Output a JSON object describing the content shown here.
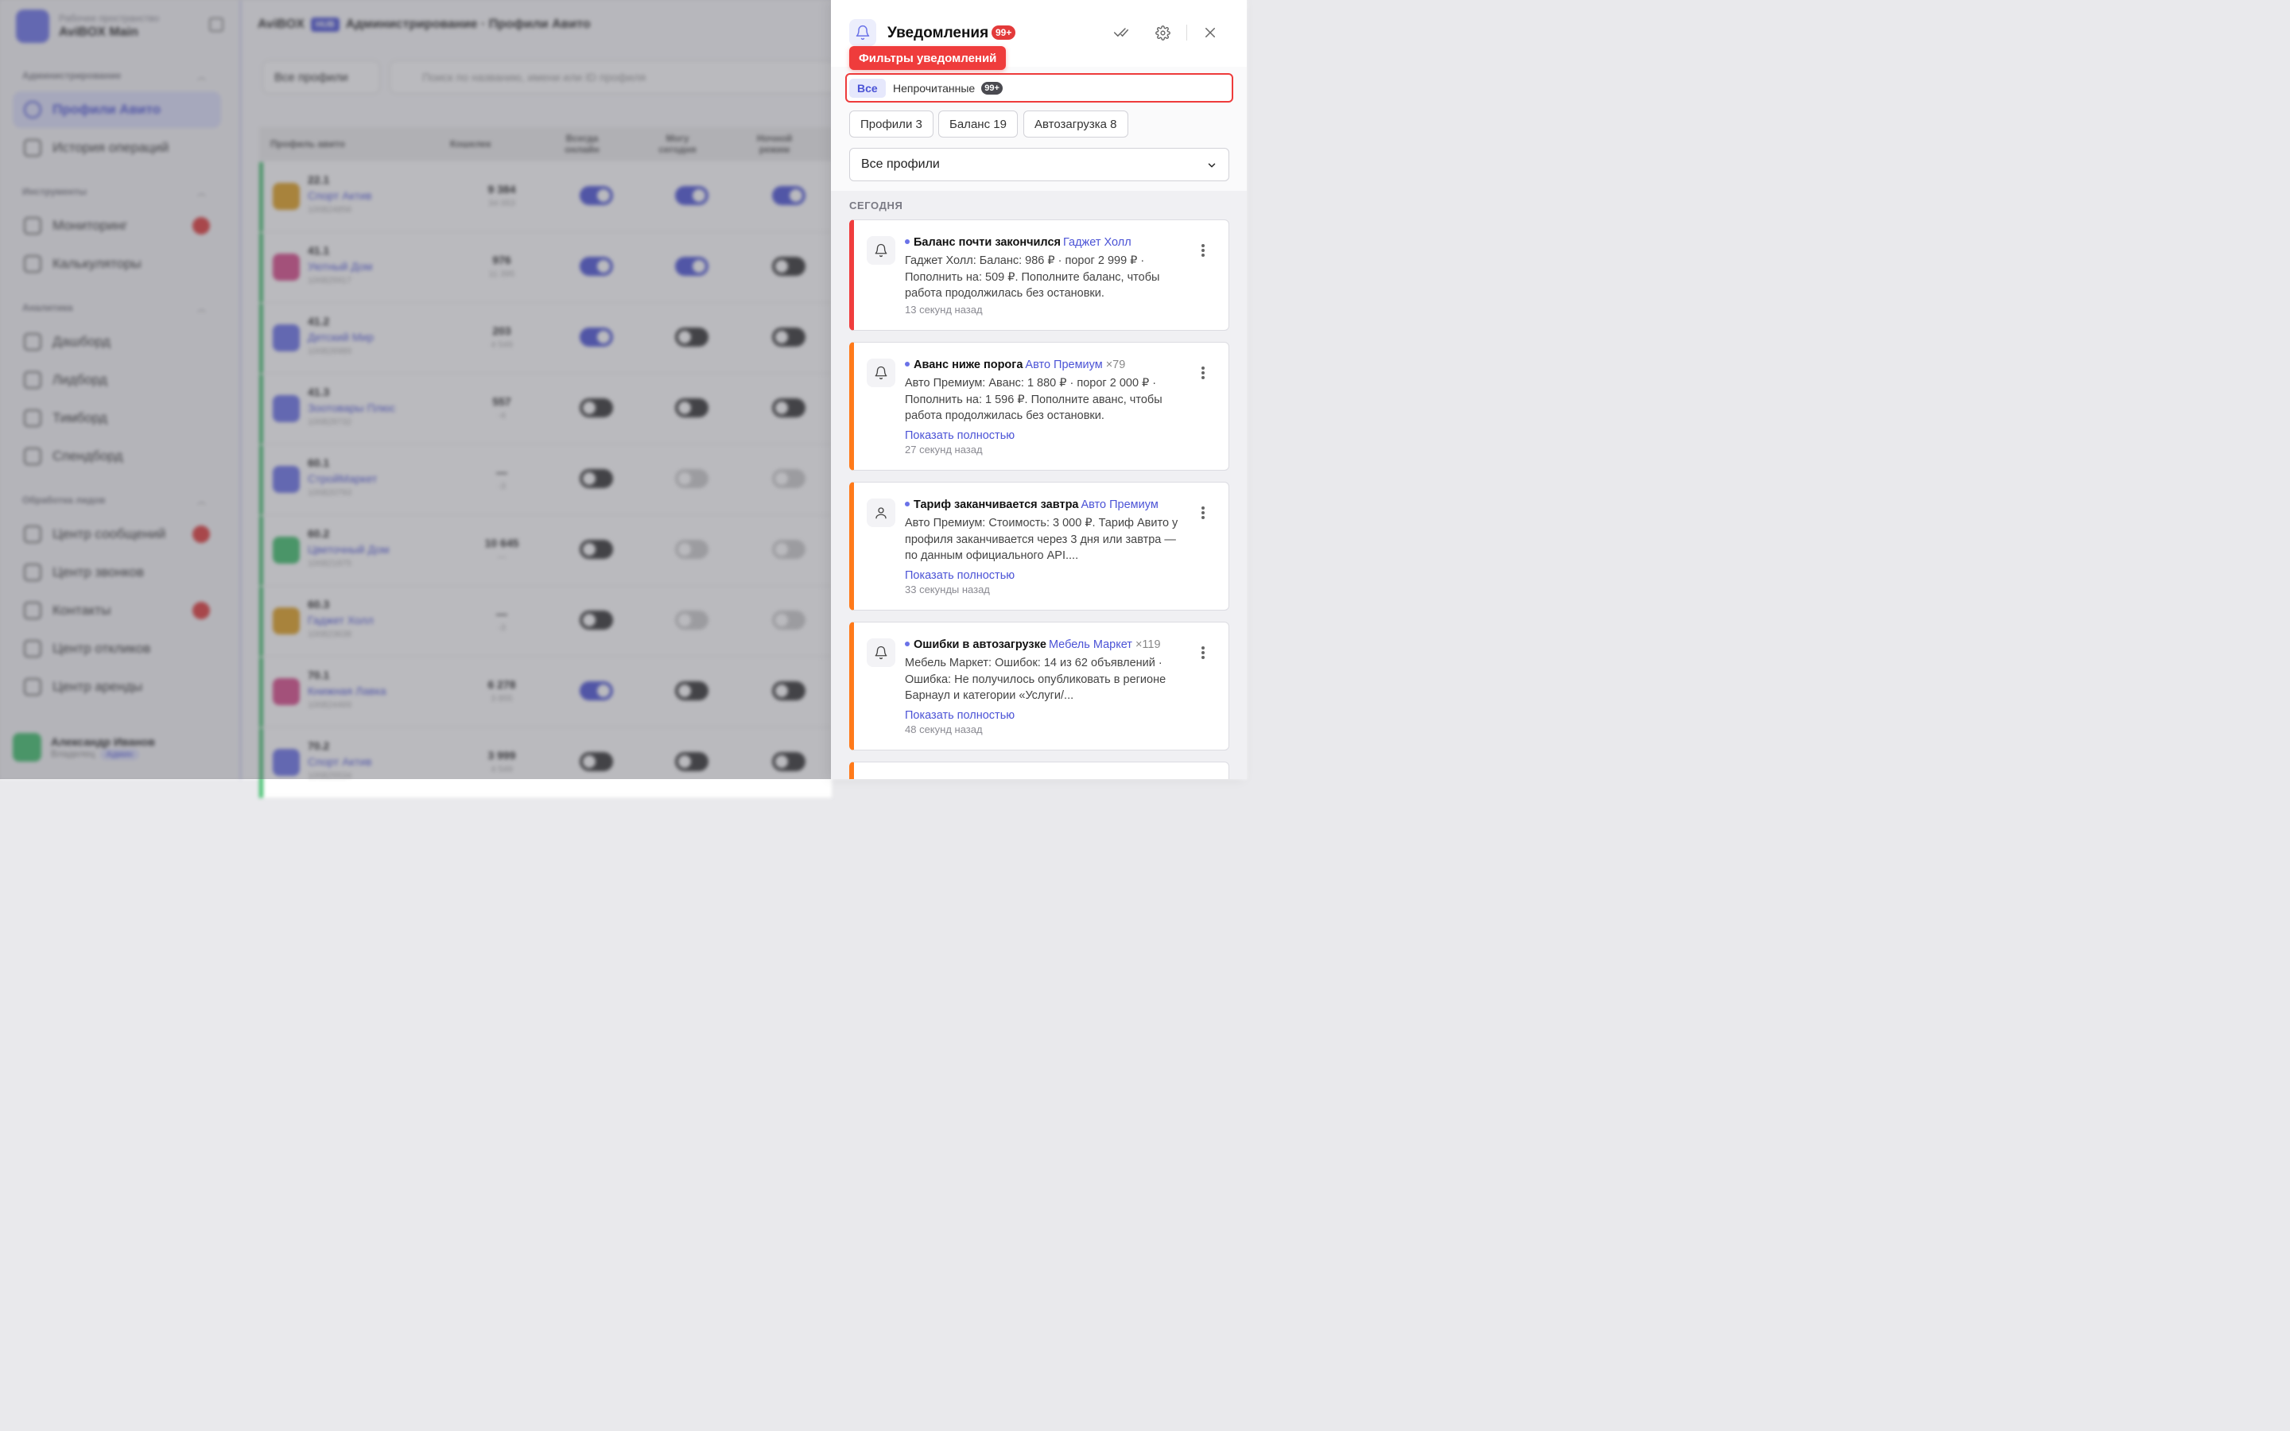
{
  "background": {
    "workspace": {
      "label": "Рабочее пространство",
      "name": "AviBOX Main"
    },
    "sections": [
      "Администрирование",
      "Инструменты",
      "Аналитика",
      "Обработка лидов"
    ],
    "nav": [
      "Профили Авито",
      "История операций",
      "Мониторинг",
      "Калькуляторы",
      "Дашборд",
      "Лидборд",
      "Тимборд",
      "Спендборд",
      "Центр сообщений",
      "Центр звонков",
      "Контакты",
      "Центр откликов",
      "Центр аренды"
    ],
    "user": {
      "name": "Александр Иванов",
      "role": "Владелец",
      "badge": "Админ"
    },
    "page": {
      "brand": "AviBOX",
      "hub": "HUB",
      "title": "Администрирование · Профили Авито"
    },
    "filter": "Все профили",
    "search_placeholder": "Поиск по названию, имени или ID профиля",
    "columns": [
      "Профиль авито",
      "Кошелек",
      "Всегда онлайн",
      "Могу сегодня",
      "Ночной режим"
    ],
    "rows": [
      {
        "id": "22.1",
        "name": "Спорт Актив",
        "num": "100824856",
        "wallet": "9 384",
        "sub": "34 053",
        "color": "#e0a020",
        "t": [
          "on",
          "on",
          "on"
        ]
      },
      {
        "id": "41.1",
        "name": "Уютный Дом",
        "num": "100825917",
        "wallet": "976",
        "sub": "11 395",
        "color": "#d84a8a",
        "t": [
          "on",
          "on",
          "off"
        ]
      },
      {
        "id": "41.2",
        "name": "Детский Мир",
        "num": "100826989",
        "wallet": "203",
        "sub": "4 549",
        "color": "#6a72e8",
        "t": [
          "on",
          "off",
          "off"
        ]
      },
      {
        "id": "41.3",
        "name": "Зоотовары Плюс",
        "num": "100829732",
        "wallet": "557",
        "sub": "-4",
        "color": "#6a72e8",
        "t": [
          "off",
          "off",
          "off"
        ]
      },
      {
        "id": "60.1",
        "name": "СтройМаркет",
        "num": "100820793",
        "wallet": "—",
        "sub": "-3",
        "color": "#6a72e8",
        "t": [
          "off",
          "light",
          "light"
        ]
      },
      {
        "id": "60.2",
        "name": "Цветочный Дом",
        "num": "100821875",
        "wallet": "10 645",
        "sub": "—",
        "color": "#3fbf6b",
        "t": [
          "off",
          "light",
          "light"
        ]
      },
      {
        "id": "60.3",
        "name": "Гаджет Холл",
        "num": "100823638",
        "wallet": "—",
        "sub": "-3",
        "color": "#e0a020",
        "t": [
          "off",
          "light",
          "light"
        ]
      },
      {
        "id": "70.1",
        "name": "Книжная Лавка",
        "num": "100824469",
        "wallet": "6 278",
        "sub": "3 855",
        "color": "#d84a8a",
        "t": [
          "on",
          "off",
          "off"
        ]
      },
      {
        "id": "70.2",
        "name": "Спорт Актив",
        "num": "100825534",
        "wallet": "3 999",
        "sub": "4 549",
        "color": "#6a72e8",
        "t": [
          "off",
          "off",
          "off"
        ]
      }
    ]
  },
  "panel": {
    "title": "Уведомления",
    "badge": "99+",
    "tooltip": "Фильтры уведомлений",
    "tabs": {
      "all": "Все",
      "unread": "Непрочитанные",
      "unread_count": "99+"
    },
    "chips": [
      "Профили 3",
      "Баланс 19",
      "Автозагрузка 8"
    ],
    "profile_select": "Все профили",
    "section": "СЕГОДНЯ",
    "notifications": [
      {
        "title": "Баланс почти закончился",
        "profile": "Гаджет Холл",
        "count": "",
        "text": "Гаджет Холл: Баланс: 986 ₽ · порог 2 999 ₽ · Пополнить на: 509 ₽. Пополните баланс, чтобы работа продолжилась без остановки.",
        "link": "",
        "time": "13 секунд назад",
        "icon": "bell-icon",
        "accent": "#f03d3d"
      },
      {
        "title": "Аванс ниже порога",
        "profile": "Авто Премиум",
        "count": "×79",
        "text": "Авто Премиум: Аванс: 1 880 ₽ · порог 2 000 ₽ · Пополнить на: 1 596 ₽. Пополните аванс, чтобы работа продолжилась без остановки.",
        "link": "Показать полностью",
        "time": "27 секунд назад",
        "icon": "bell-icon",
        "accent": "#ff7a1a"
      },
      {
        "title": "Тариф заканчивается завтра",
        "profile": "Авто Премиум",
        "count": "",
        "text": "Авто Премиум: Стоимость: 3 000 ₽. Тариф Авито у профиля заканчивается через 3 дня или завтра — по данным официального API....",
        "link": "Показать полностью",
        "time": "33 секунды назад",
        "icon": "user-icon",
        "accent": "#ff7a1a"
      },
      {
        "title": "Ошибки в автозагрузке",
        "profile": "Мебель Маркет",
        "count": "×119",
        "text": "Мебель Маркет: Ошибок: 14 из 62 объявлений · Ошибка: Не получилось опубликовать в регионе Барнаул и категории «Услуги/...",
        "link": "Показать полностью",
        "time": "48 секунд назад",
        "icon": "bell-icon",
        "accent": "#ff7a1a"
      }
    ]
  }
}
